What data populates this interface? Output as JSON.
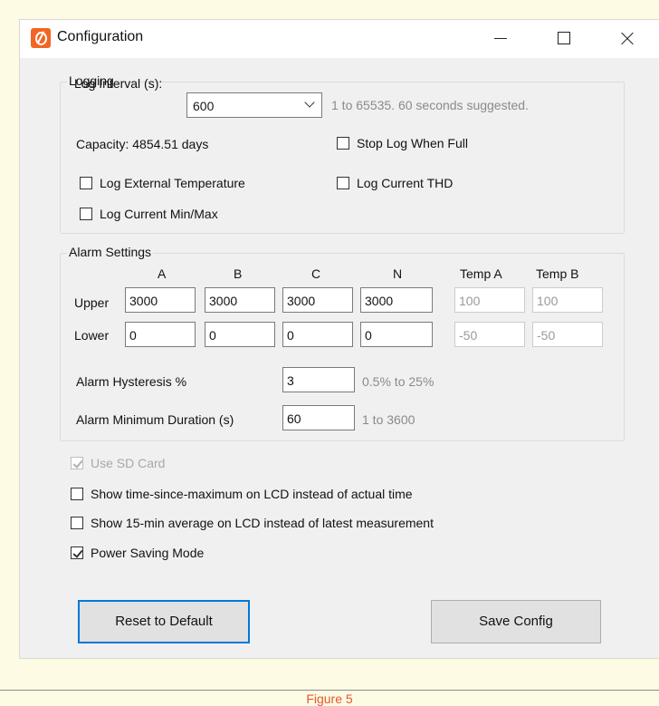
{
  "window": {
    "title": "Configuration",
    "controls": {
      "minimize": "minimize",
      "maximize": "maximize",
      "close": "close"
    }
  },
  "logging": {
    "legend": "Logging",
    "interval_label": "Log Interval (s):",
    "interval_value": "600",
    "interval_hint": "1 to 65535. 60 seconds suggested.",
    "capacity": "Capacity: 4854.51 days",
    "stop_when_full": {
      "label": "Stop Log When Full",
      "checked": false
    },
    "external_temp": {
      "label": "Log External Temperature",
      "checked": false
    },
    "current_thd": {
      "label": "Log Current THD",
      "checked": false
    },
    "current_minmax": {
      "label": "Log Current Min/Max",
      "checked": false
    }
  },
  "alarm": {
    "legend": "Alarm Settings",
    "columns": [
      "A",
      "B",
      "C",
      "N",
      "Temp A",
      "Temp B"
    ],
    "upper_label": "Upper",
    "upper": [
      "3000",
      "3000",
      "3000",
      "3000",
      "100",
      "100"
    ],
    "lower_label": "Lower",
    "lower": [
      "0",
      "0",
      "0",
      "0",
      "-50",
      "-50"
    ],
    "hysteresis_label": "Alarm Hysteresis %",
    "hysteresis_value": "3",
    "hysteresis_hint": "0.5% to 25%",
    "min_duration_label": "Alarm Minimum Duration (s)",
    "min_duration_value": "60",
    "min_duration_hint": "1 to 3600"
  },
  "options": {
    "sd_card": {
      "label": "Use SD Card",
      "checked": true,
      "enabled": false
    },
    "time_since_max": {
      "label": "Show time-since-maximum on LCD instead of actual time",
      "checked": false
    },
    "avg_15min": {
      "label": "Show 15-min average on LCD instead of latest measurement",
      "checked": false
    },
    "power_saving": {
      "label": "Power Saving Mode",
      "checked": true
    }
  },
  "buttons": {
    "reset": "Reset to Default",
    "save": "Save Config"
  },
  "caption": "Figure 5",
  "colors": {
    "accent": "#0078d7",
    "app_icon": "#f26522",
    "caption": "#e4572e",
    "page_bg": "#fdfbe3"
  }
}
